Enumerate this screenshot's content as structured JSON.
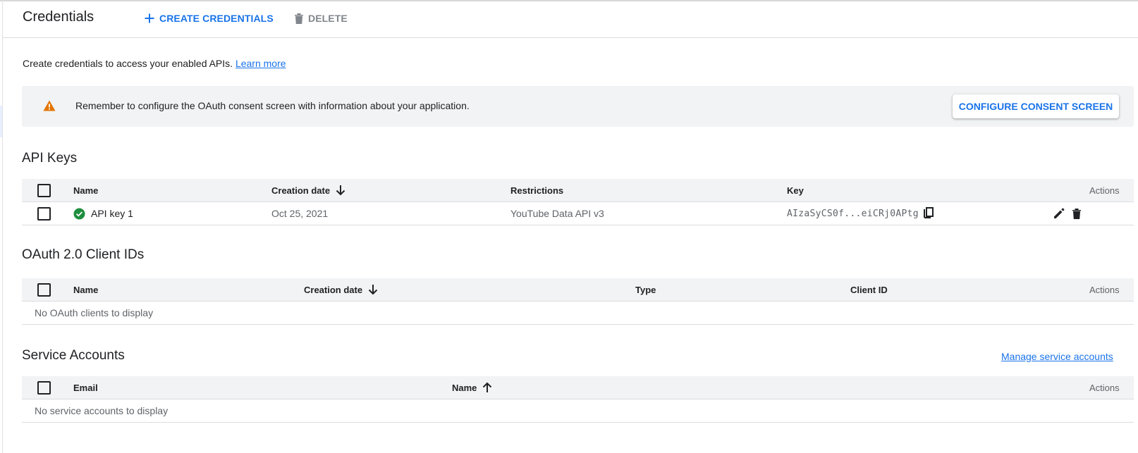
{
  "header": {
    "title": "Credentials",
    "create_label": "CREATE CREDENTIALS",
    "delete_label": "DELETE"
  },
  "intro": {
    "text": "Create credentials to access your enabled APIs.",
    "link": "Learn more"
  },
  "banner": {
    "message": "Remember to configure the OAuth consent screen with information about your application.",
    "button_label": "CONFIGURE CONSENT SCREEN"
  },
  "api_keys": {
    "title": "API Keys",
    "columns": {
      "name": "Name",
      "creation_date": "Creation date",
      "restrictions": "Restrictions",
      "key": "Key",
      "actions": "Actions"
    },
    "rows": [
      {
        "name": "API key 1",
        "creation_date": "Oct 25, 2021",
        "restrictions": "YouTube Data API v3",
        "key": "AIzaSyCS0f...eiCRj0APtg",
        "status": "ok"
      }
    ]
  },
  "oauth": {
    "title": "OAuth 2.0 Client IDs",
    "columns": {
      "name": "Name",
      "creation_date": "Creation date",
      "type": "Type",
      "client_id": "Client ID",
      "actions": "Actions"
    },
    "empty": "No OAuth clients to display"
  },
  "service_accounts": {
    "title": "Service Accounts",
    "manage_link": "Manage service accounts",
    "columns": {
      "email": "Email",
      "name": "Name",
      "actions": "Actions"
    },
    "empty": "No service accounts to display"
  },
  "colors": {
    "accent": "#1a73e8",
    "warning": "#e37400",
    "success": "#1e8e3e",
    "header_bg": "#f1f3f4"
  },
  "icons": [
    "add-icon",
    "delete-icon",
    "warning-icon",
    "arrow-down-icon",
    "arrow-up-icon",
    "check-circle-icon",
    "copy-icon",
    "edit-icon",
    "trash-icon"
  ]
}
